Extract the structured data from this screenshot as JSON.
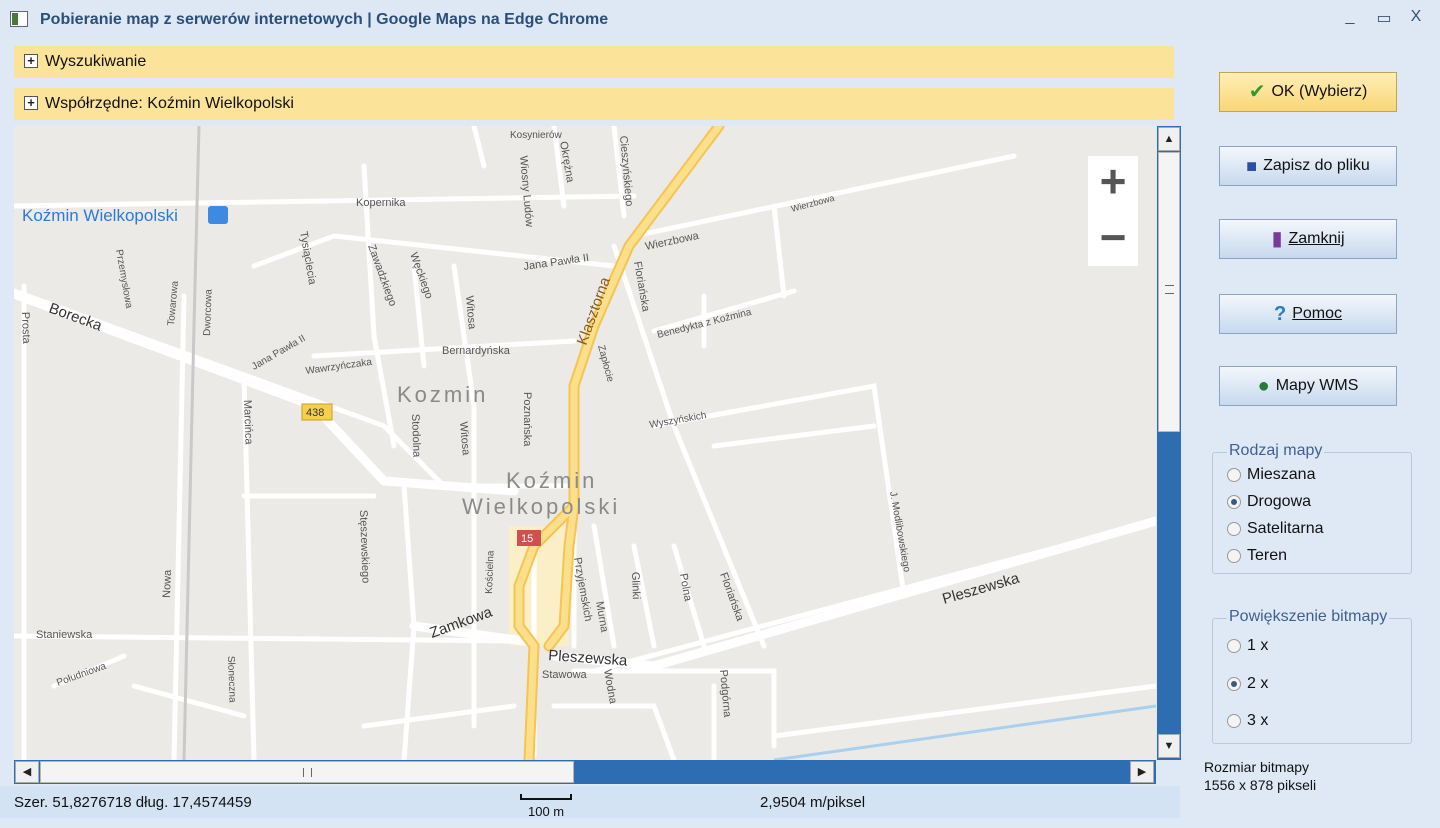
{
  "window": {
    "title": "Pobieranie map z serwerów internetowych  | Google Maps na Edge Chrome",
    "minimize": "_",
    "maximize": "▭",
    "close": "X"
  },
  "panels": {
    "search_label": "Wyszukiwanie",
    "coords_label": "Współrzędne:  Koźmin Wielkopolski"
  },
  "map": {
    "zoom_in": "+",
    "zoom_out": "−",
    "labels": {
      "place_blue": "Koźmin Wielkopolski",
      "district": "Kozmin",
      "town_line1": "Koźmin",
      "town_line2": "Wielkopolski",
      "route_438": "438",
      "route_15": "15",
      "klasztorna": "Klasztorna",
      "pleszewska_e": "Pleszewska",
      "pleszewska_c": "Pleszewska",
      "zamkowa": "Zamkowa",
      "borecka": "Borecka",
      "wierzbowa1": "Wierzbowa",
      "wierzbowa2": "Wierzbowa",
      "kopernika": "Kopernika",
      "kosynierow": "Kosynierów",
      "jana_pawla_1": "Jana Pawła II",
      "jana_pawla_2": "Jana Pawła II",
      "bernardynska": "Bernardyńska",
      "wawrzynczaka": "Wawrzyńczaka",
      "benedykta": "Benedykta z Koźmina",
      "wyszynskich": "Wyszyńskich",
      "staniewska": "Staniewska",
      "stawowa": "Stawowa",
      "poludniowa": "Południowa",
      "modlibowskiego": "J. Modlibowskiego",
      "floriańska": "Floriańska",
      "florianska2": "Floriańska",
      "polna": "Polna",
      "podgorna": "Podgórna",
      "glinki": "Glinki",
      "murna": "Murna",
      "przyjemskich": "Przyjemskich",
      "koscielna": "Kościelna",
      "wodna": "Wodna",
      "stodolna": "Stodolna",
      "witosa1": "Witosa",
      "witosa2": "Witosa",
      "poznanska": "Poznańska",
      "steszewskiego": "Stęszewskiego",
      "marcinca": "Marcińca",
      "nowa": "Nowa",
      "sloneczna": "Słoneczna",
      "prosta": "Prosta",
      "przemyslowa": "Przemysłowa",
      "towarowa": "Towarowa",
      "dworcowa": "Dworcowa",
      "tysiaclecia": "Tysiąclecia",
      "zawadzkiego": "Zawadzkiego",
      "weckiego": "Węckiego",
      "wiosny_ludow": "Wiosny Ludów",
      "okrezna": "Okrężna",
      "cieszynskiego": "Cieszyńskiego",
      "zaplocie": "Zapłocie"
    }
  },
  "status": {
    "coords": "Szer. 51,8276718 dług. 17,4574459",
    "scale": "100 m",
    "resolution": "2,9504 m/piksel"
  },
  "buttons": {
    "ok": "OK (Wybierz)",
    "save": "Zapisz do pliku",
    "close": "Zamknij",
    "help": "Pomoc",
    "wms": "Mapy WMS"
  },
  "map_type": {
    "legend": "Rodzaj mapy",
    "options": [
      "Mieszana",
      "Drogowa",
      "Satelitarna",
      "Teren"
    ],
    "selected": "Drogowa"
  },
  "bitmap_zoom": {
    "legend": "Powiększenie bitmapy",
    "options": [
      "1 x",
      "2 x",
      "3 x"
    ],
    "selected": "2 x"
  },
  "bitmap_size": {
    "label": "Rozmiar bitmapy",
    "value": "1556 x 878 pikseli"
  },
  "colors": {
    "accent": "#2f6db2",
    "panel": "#fbe39a",
    "road_major": "#fcd56a"
  }
}
